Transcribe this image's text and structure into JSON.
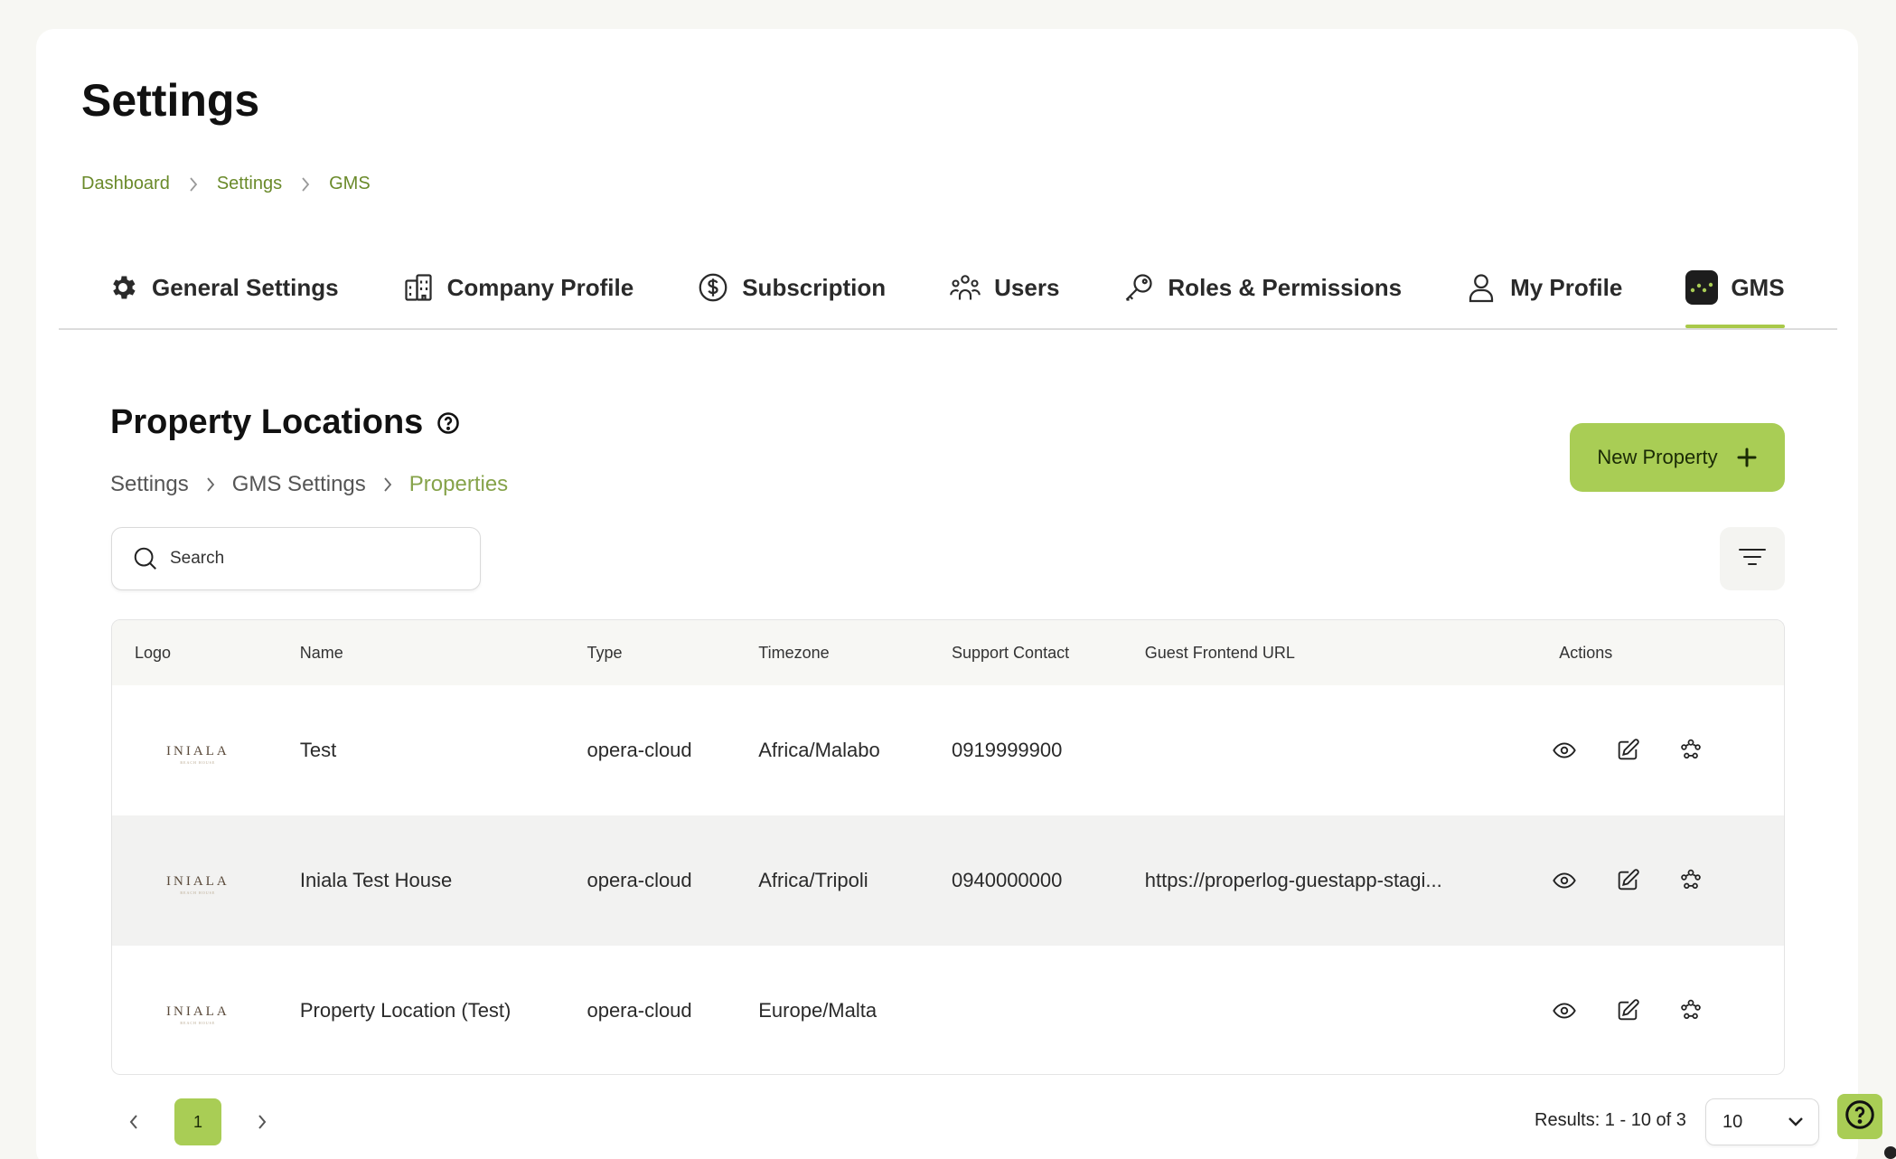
{
  "page": {
    "title": "Settings"
  },
  "breadcrumb": [
    "Dashboard",
    "Settings",
    "GMS"
  ],
  "tabs": [
    {
      "label": "General Settings",
      "icon": "gear-icon"
    },
    {
      "label": "Company Profile",
      "icon": "building-icon"
    },
    {
      "label": "Subscription",
      "icon": "dollar-circle-icon"
    },
    {
      "label": "Users",
      "icon": "users-icon"
    },
    {
      "label": "Roles & Permissions",
      "icon": "key-icon"
    },
    {
      "label": "My Profile",
      "icon": "person-icon"
    },
    {
      "label": "GMS",
      "icon": "gms-logo-icon",
      "active": true
    }
  ],
  "section": {
    "title": "Property Locations",
    "breadcrumb": [
      "Settings",
      "GMS Settings",
      "Properties"
    ]
  },
  "new_button": {
    "label": "New Property"
  },
  "search": {
    "placeholder": "Search",
    "value": ""
  },
  "table": {
    "headers": [
      "Logo",
      "Name",
      "Type",
      "Timezone",
      "Support Contact",
      "Guest Frontend URL",
      "Actions"
    ],
    "rows": [
      {
        "logo": "INIALA",
        "logo_tag": "BEACH HOUSE",
        "name": "Test",
        "type": "opera-cloud",
        "timezone": "Africa/Malabo",
        "contact": "0919999900",
        "url": ""
      },
      {
        "logo": "INIALA",
        "logo_tag": "BEACH HOUSE",
        "name": "Iniala Test House",
        "type": "opera-cloud",
        "timezone": "Africa/Tripoli",
        "contact": "0940000000",
        "url": "https://properlog-guestapp-stagi..."
      },
      {
        "logo": "INIALA",
        "logo_tag": "BEACH HOUSE",
        "name": "Property Location (Test)",
        "type": "opera-cloud",
        "timezone": "Europe/Malta",
        "contact": "",
        "url": ""
      }
    ]
  },
  "pagination": {
    "current_page": "1",
    "results_text": "Results: 1 - 10 of 3",
    "per_page": "10"
  },
  "colors": {
    "accent": "#a9cd55",
    "link": "#6a8a2a",
    "background": "#f7f7f3"
  }
}
